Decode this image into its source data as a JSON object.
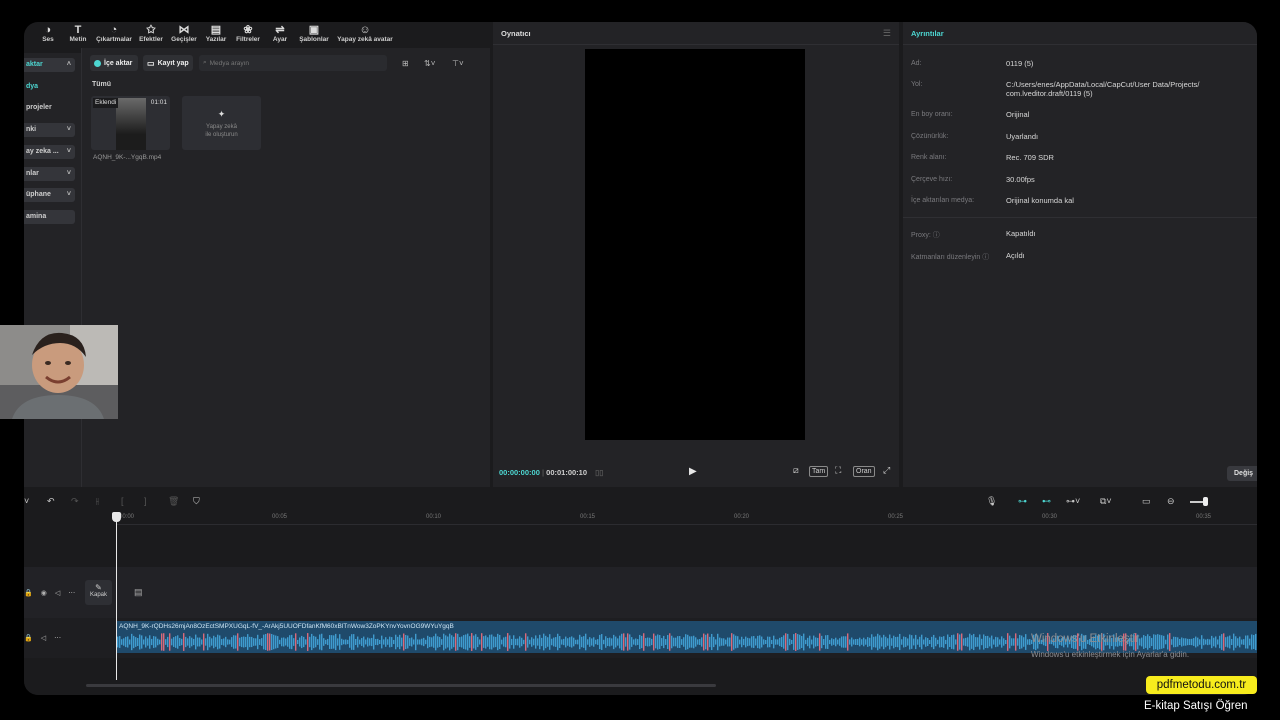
{
  "toolbar": {
    "items": [
      {
        "label": "Ses",
        "icon": "audio-icon"
      },
      {
        "label": "Metin",
        "icon": "text-icon"
      },
      {
        "label": "Çıkartmalar",
        "icon": "sticker-icon"
      },
      {
        "label": "Efektler",
        "icon": "effects-icon"
      },
      {
        "label": "Geçişler",
        "icon": "transitions-icon"
      },
      {
        "label": "Yazılar",
        "icon": "captions-icon"
      },
      {
        "label": "Filtreler",
        "icon": "filters-icon"
      },
      {
        "label": "Ayar",
        "icon": "adjust-icon"
      },
      {
        "label": "Şablonlar",
        "icon": "templates-icon"
      },
      {
        "label": "Yapay zekâ avatar",
        "icon": "ai-avatar-icon"
      }
    ]
  },
  "sidebar": {
    "items": [
      {
        "label": "aktar",
        "chevron": "˄"
      },
      {
        "label": "dya"
      },
      {
        "label": "projeler"
      },
      {
        "label": "nki",
        "chevron": "˅"
      },
      {
        "label": "ay zeka ...",
        "chevron": "˅"
      },
      {
        "label": "nlar",
        "chevron": "˅"
      },
      {
        "label": "üphane",
        "chevron": "˅"
      },
      {
        "label": "amina"
      }
    ]
  },
  "media": {
    "import_label": "İçe aktar",
    "record_label": "Kayıt yap",
    "search_placeholder": "Medya arayın",
    "filter_all": "Tümü",
    "clip": {
      "added": "Eklendi",
      "duration": "01:01",
      "name": "AQNH_9K-...YgqB.mp4"
    },
    "ai_card_label": "Yapay zekâ ile oluşturun"
  },
  "player": {
    "title": "Oynatıcı",
    "current_time": "00:00:00:00",
    "total_time": "00:01:00:10",
    "full_label": "Tam",
    "ratio_label": "Oran"
  },
  "details": {
    "title": "Ayrıntılar",
    "rows": [
      {
        "label": "Ad:",
        "value": "0119 (5)"
      },
      {
        "label": "Yol:",
        "value": "C:/Users/enes/AppData/Local/CapCut/User Data/Projects/",
        "value2": "com.lveditor.draft/0119 (5)"
      },
      {
        "label": "En boy oranı:",
        "value": "Orijinal"
      },
      {
        "label": "Çözünürlük:",
        "value": "Uyarlandı"
      },
      {
        "label": "Renk alanı:",
        "value": "Rec. 709 SDR"
      },
      {
        "label": "Çerçeve hızı:",
        "value": "30.00fps"
      },
      {
        "label": "İçe aktarılan medya:",
        "value": "Orijinal konumda kal"
      },
      {
        "label": "Proxy:",
        "value": "Kapatıldı"
      },
      {
        "label": "Katmanları düzenleyin",
        "value": "Açıldı"
      }
    ],
    "change_label": "Değiş"
  },
  "timeline": {
    "ticks": [
      "00:00",
      "00:05",
      "00:10",
      "00:15",
      "00:20",
      "00:25",
      "00:30",
      "00:35"
    ],
    "cover_label": "Kapak",
    "audio_clip_name": "AQNH_9K-rQDHs26mjAn8OzEctSMPXUGqL-fV_-ArAkj5UUOFDfanKfM60xBlTnWow3ZoPKYnvYovnOG9WYuYgqB"
  },
  "watermark": {
    "title": "Windows'u Etkinleştir",
    "subtitle": "Windows'u etkinleştirmek için Ayarlar'a gidin."
  },
  "overlay": {
    "site": "pdfmetodu.com.tr",
    "tagline": "E-kitap Satışı Öğren"
  },
  "colors": {
    "accent": "#4dd7d2",
    "badge": "#f7ec1d",
    "audio_clip": "#1f4a6b"
  }
}
